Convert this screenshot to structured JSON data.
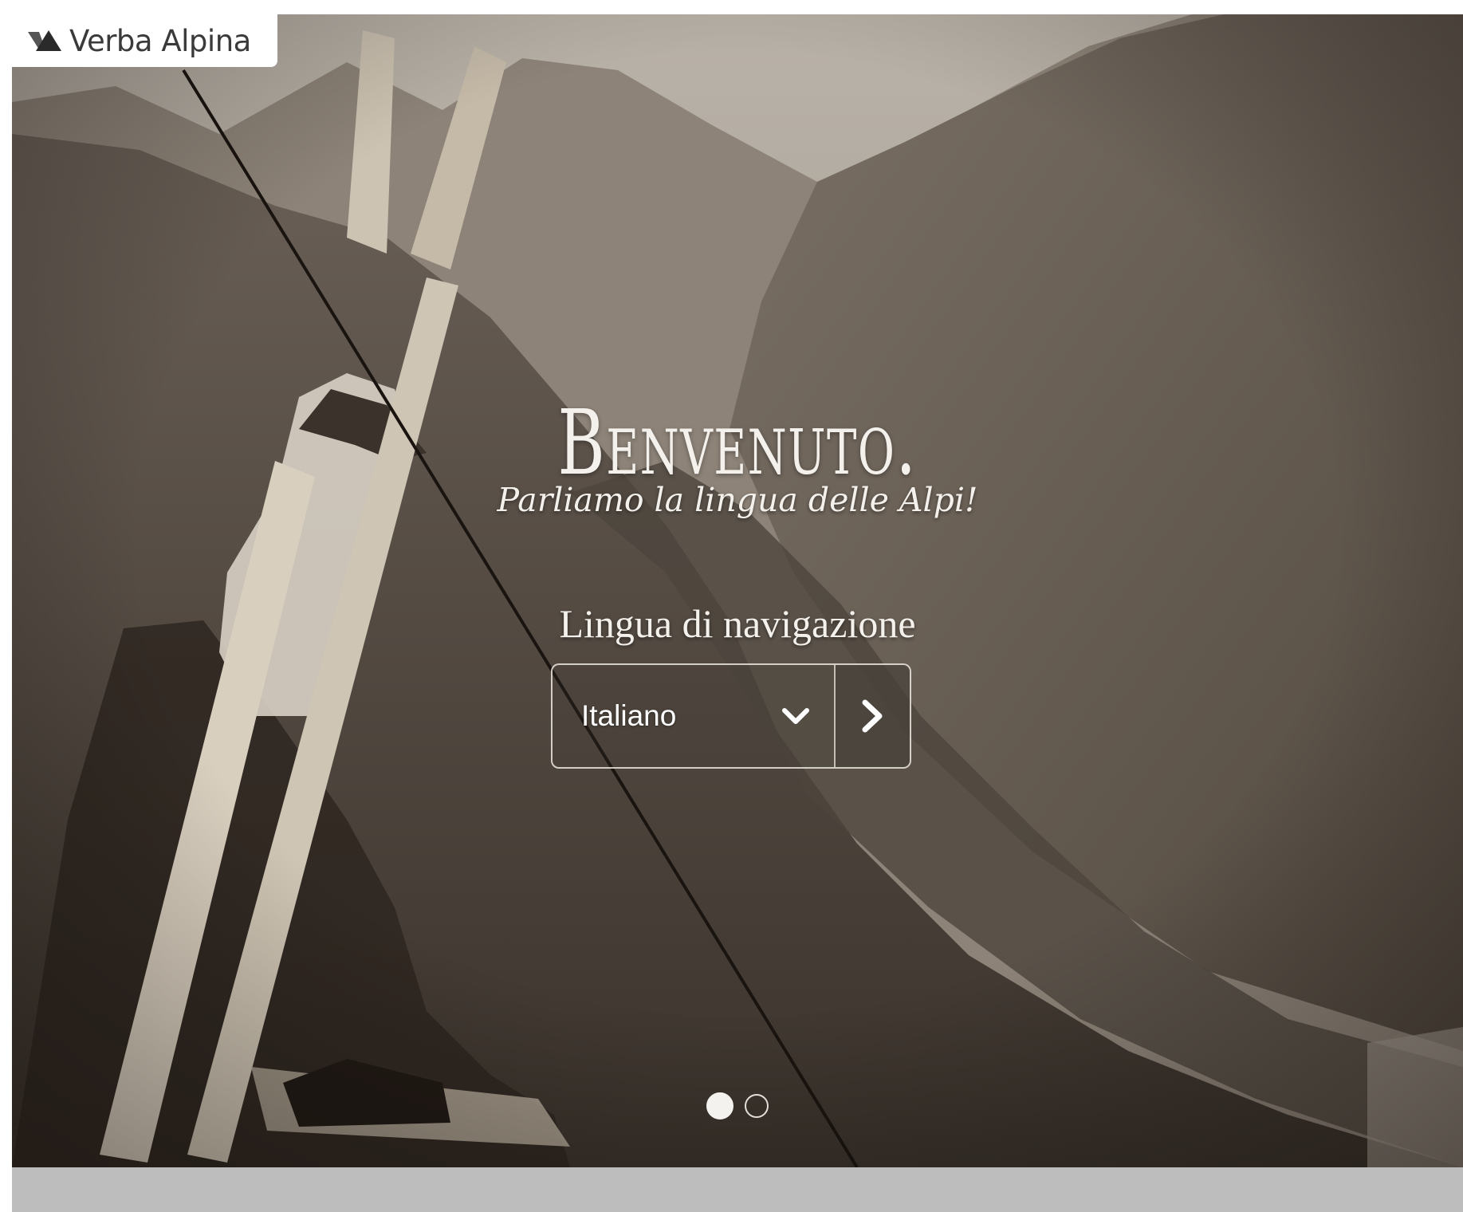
{
  "header": {
    "logo_text": "Verba Alpina",
    "logo_icon": "mountain-logo-icon"
  },
  "hero": {
    "title": "Benvenuto.",
    "tagline": "Parliamo la lingua delle Alpi!",
    "language_label": "Lingua di navigazione",
    "language_select": {
      "selected": "Italiano",
      "icon": "chevron-down-icon"
    },
    "submit_icon": "chevron-right-icon",
    "carousel": {
      "slide_count": 2,
      "active_index": 0
    }
  },
  "colors": {
    "photo_tone": "#6e645b",
    "text": "#f4f1ec",
    "footer_band": "#bdbdbd"
  }
}
